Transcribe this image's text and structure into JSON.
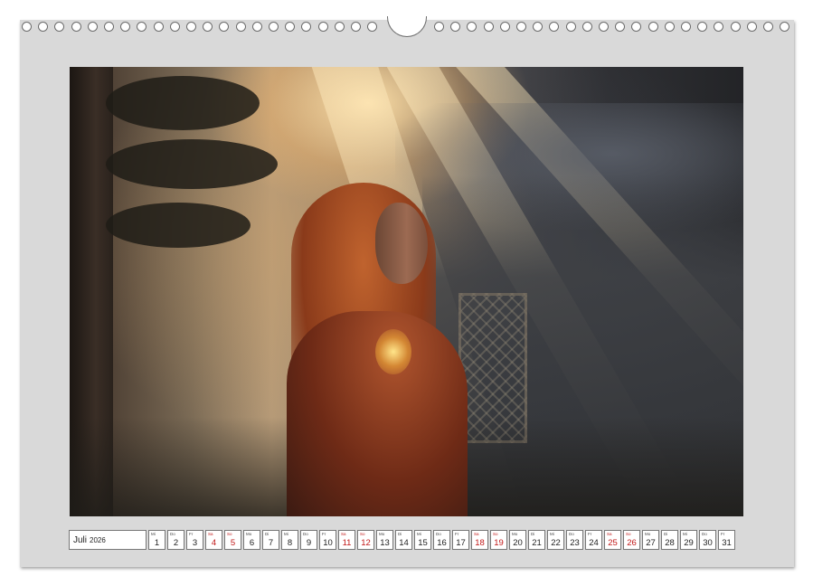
{
  "calendar": {
    "month": "Juli",
    "year": "2026",
    "days": [
      {
        "wd": "Mi",
        "n": "1",
        "we": false
      },
      {
        "wd": "Do",
        "n": "2",
        "we": false
      },
      {
        "wd": "Fr",
        "n": "3",
        "we": false
      },
      {
        "wd": "Sa",
        "n": "4",
        "we": true
      },
      {
        "wd": "So",
        "n": "5",
        "we": true
      },
      {
        "wd": "Mo",
        "n": "6",
        "we": false
      },
      {
        "wd": "Di",
        "n": "7",
        "we": false
      },
      {
        "wd": "Mi",
        "n": "8",
        "we": false
      },
      {
        "wd": "Do",
        "n": "9",
        "we": false
      },
      {
        "wd": "Fr",
        "n": "10",
        "we": false
      },
      {
        "wd": "Sa",
        "n": "11",
        "we": true
      },
      {
        "wd": "So",
        "n": "12",
        "we": true
      },
      {
        "wd": "Mo",
        "n": "13",
        "we": false
      },
      {
        "wd": "Di",
        "n": "14",
        "we": false
      },
      {
        "wd": "Mi",
        "n": "15",
        "we": false
      },
      {
        "wd": "Do",
        "n": "16",
        "we": false
      },
      {
        "wd": "Fr",
        "n": "17",
        "we": false
      },
      {
        "wd": "Sa",
        "n": "18",
        "we": true
      },
      {
        "wd": "So",
        "n": "19",
        "we": true
      },
      {
        "wd": "Mo",
        "n": "20",
        "we": false
      },
      {
        "wd": "Di",
        "n": "21",
        "we": false
      },
      {
        "wd": "Mi",
        "n": "22",
        "we": false
      },
      {
        "wd": "Do",
        "n": "23",
        "we": false
      },
      {
        "wd": "Fr",
        "n": "24",
        "we": false
      },
      {
        "wd": "Sa",
        "n": "25",
        "we": true
      },
      {
        "wd": "So",
        "n": "26",
        "we": true
      },
      {
        "wd": "Mo",
        "n": "27",
        "we": false
      },
      {
        "wd": "Di",
        "n": "28",
        "we": false
      },
      {
        "wd": "Mi",
        "n": "29",
        "we": false
      },
      {
        "wd": "Do",
        "n": "30",
        "we": false
      },
      {
        "wd": "Fr",
        "n": "31",
        "we": false
      }
    ]
  },
  "colors": {
    "weekend": "#c21818",
    "page": "#d9d9d9"
  },
  "icons": {
    "binding": "wire-binding-hole-icon",
    "hanger": "calendar-hanger-icon"
  }
}
